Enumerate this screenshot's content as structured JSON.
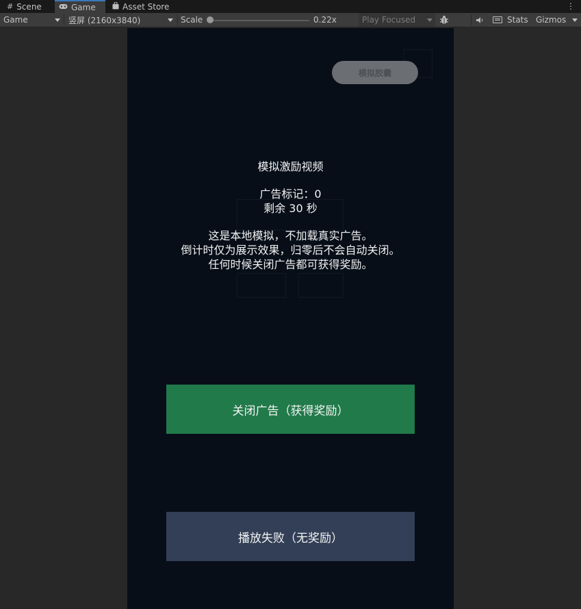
{
  "tabs": {
    "scene": "Scene",
    "game": "Game",
    "asset_store": "Asset Store",
    "scene_icon": "grid-icon",
    "game_icon": "gamepad-icon",
    "asset_icon": "shopping-bag-icon"
  },
  "toolbar": {
    "display": "Game",
    "resolution": "竖屏 (2160x3840)",
    "scale_label": "Scale",
    "scale_value": "0.22x",
    "play_mode": "Play Focused",
    "stats": "Stats",
    "gizmos": "Gizmos",
    "bug_icon": "bug-icon",
    "mute_icon": "speaker-icon",
    "keyboard_icon": "keyboard-icon"
  },
  "game": {
    "sim_button": "模拟胶囊",
    "ad_title": "模拟激励视频",
    "ad_mark": "广告标记：0",
    "ad_remaining": "剩余 30 秒",
    "notice_line1": "这是本地模拟，不加载真实广告。",
    "notice_line2": "倒计时仅为展示效果，归零后不会自动关闭。",
    "notice_line3": "任何时候关闭广告都可获得奖励。",
    "close_button": "关闭广告（获得奖励）",
    "fail_button": "播放失败（无奖励）"
  },
  "colors": {
    "editor_bg": "#282828",
    "screen_bg": "#070e18",
    "close_button": "#217a4a",
    "fail_button": "#323f56",
    "tab_accent": "#3a79bb"
  }
}
